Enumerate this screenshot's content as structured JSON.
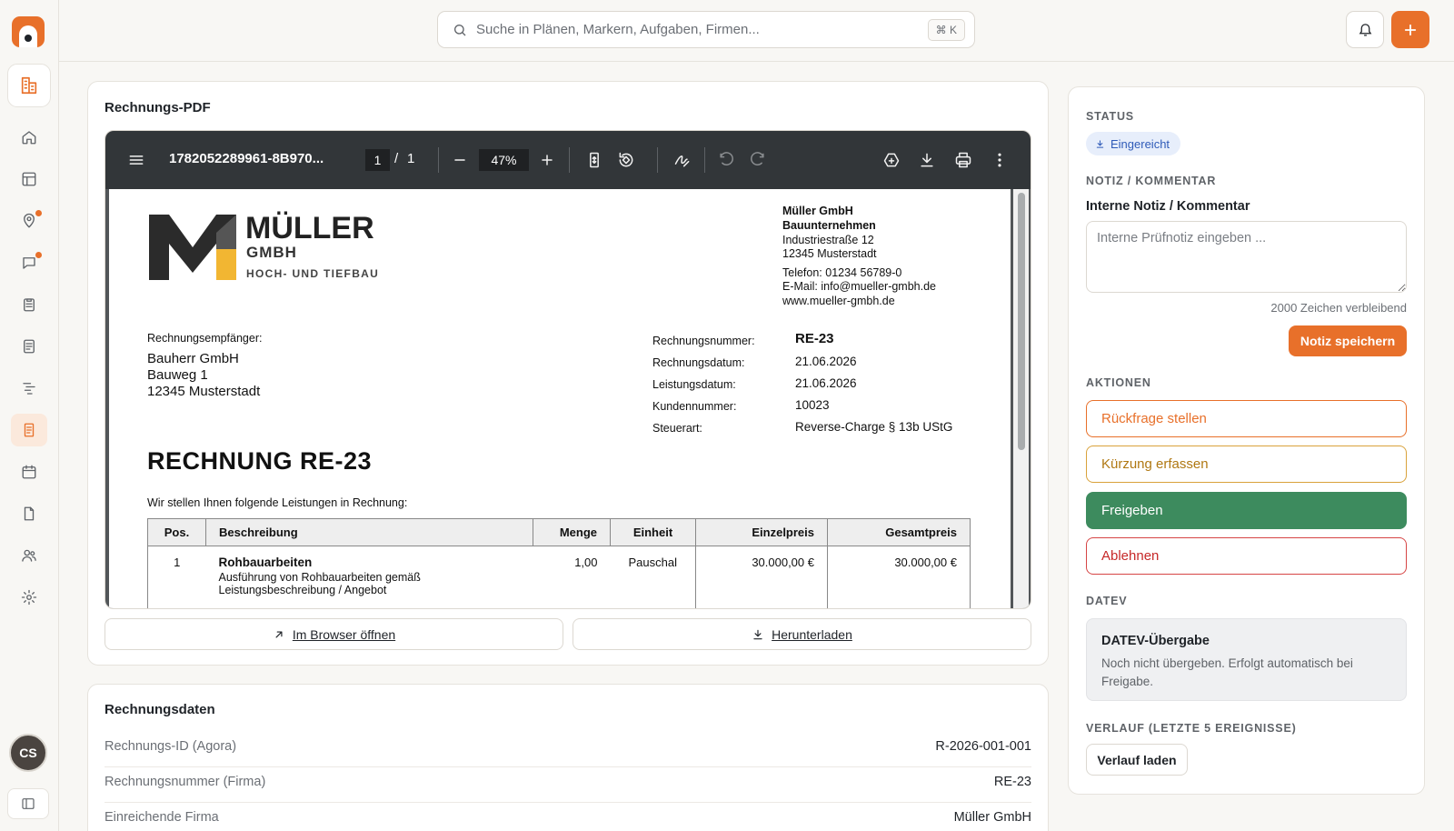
{
  "search": {
    "placeholder": "Suche in Plänen, Markern, Aufgaben, Firmen...",
    "shortcut": "⌘ K"
  },
  "user": {
    "initials": "CS"
  },
  "pdf_card": {
    "title": "Rechnungs-PDF",
    "toolbar": {
      "filename": "1782052289961-8B970...",
      "page_current": "1",
      "page_sep": "/",
      "page_total": "1",
      "zoom": "47%"
    },
    "open_browser_label": "Im Browser öffnen",
    "download_label": "Herunterladen"
  },
  "document": {
    "logo_name": "MÜLLER",
    "logo_sub": "GMBH",
    "logo_tagline": "HOCH- UND TIEFBAU",
    "sender": {
      "line1": "Müller GmbH",
      "line2": "Bauunternehmen",
      "line3": "Industriestraße 12",
      "line4": "12345 Musterstadt",
      "phone": "Telefon: 01234 56789-0",
      "email": "E-Mail: info@mueller-gmbh.de",
      "web": "www.mueller-gmbh.de"
    },
    "recipient_label": "Rechnungsempfänger:",
    "recipient": {
      "line1": "Bauherr GmbH",
      "line2": "Bauweg 1",
      "line3": "12345 Musterstadt"
    },
    "meta": [
      {
        "label": "Rechnungsnummer:",
        "value": "RE-23"
      },
      {
        "label": "Rechnungsdatum:",
        "value": "21.06.2026"
      },
      {
        "label": "Leistungsdatum:",
        "value": "21.06.2026"
      },
      {
        "label": "Kundennummer:",
        "value": "10023"
      },
      {
        "label": "Steuerart:",
        "value": "Reverse-Charge § 13b UStG"
      }
    ],
    "heading": "RECHNUNG RE-23",
    "intro": "Wir stellen Ihnen folgende Leistungen in Rechnung:",
    "table": {
      "headers": {
        "pos": "Pos.",
        "desc": "Beschreibung",
        "qty": "Menge",
        "unit": "Einheit",
        "price": "Einzelpreis",
        "total": "Gesamtpreis"
      },
      "rows": [
        {
          "pos": "1",
          "title": "Rohbauarbeiten",
          "desc1": "Ausführung von Rohbauarbeiten gemäß",
          "desc2": "Leistungsbeschreibung / Angebot",
          "qty": "1,00",
          "unit": "Pauschal",
          "price": "30.000,00 €",
          "total": "30.000,00 €"
        }
      ]
    }
  },
  "invoice_data": {
    "title": "Rechnungsdaten",
    "rows": [
      {
        "label": "Rechnungs-ID (Agora)",
        "value": "R-2026-001-001"
      },
      {
        "label": "Rechnungsnummer (Firma)",
        "value": "RE-23"
      },
      {
        "label": "Einreichende Firma",
        "value": "Müller GmbH"
      }
    ]
  },
  "side": {
    "status_label": "STATUS",
    "status_value": "Eingereicht",
    "note_section": "NOTIZ / KOMMENTAR",
    "note_label": "Interne Notiz / Kommentar",
    "note_placeholder": "Interne Prüfnotiz eingeben ...",
    "note_remaining": "2000 Zeichen verbleibend",
    "note_save": "Notiz speichern",
    "actions_label": "AKTIONEN",
    "actions": {
      "query": "Rückfrage stellen",
      "reduce": "Kürzung erfassen",
      "approve": "Freigeben",
      "reject": "Ablehnen"
    },
    "datev_label": "DATEV",
    "datev_title": "DATEV-Übergabe",
    "datev_desc": "Noch nicht übergeben. Erfolgt automatisch bei Freigabe.",
    "history_label": "VERLAUF (LETZTE 5 EREIGNISSE)",
    "history_button": "Verlauf laden"
  },
  "colors": {
    "accent": "#e8702a",
    "approve": "#3d8b5e",
    "reject": "#c62828",
    "reduce": "#b07812",
    "status": "#2f5bb8"
  }
}
